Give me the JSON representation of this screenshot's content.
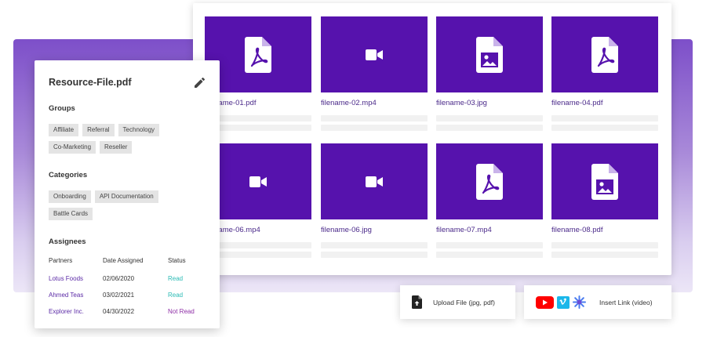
{
  "detail": {
    "title": "Resource-File.pdf",
    "groups_heading": "Groups",
    "groups": [
      "Affiliate",
      "Referral",
      "Technology",
      "Co-Marketing",
      "Reseller"
    ],
    "categories_heading": "Categories",
    "categories": [
      "Onboarding",
      "API Documentation",
      "Battle Cards"
    ],
    "assignees_heading": "Assignees",
    "table": {
      "headers": [
        "Partners",
        "Date Assigned",
        "Status"
      ],
      "rows": [
        {
          "partner": "Lotus Foods",
          "date": "02/06/2020",
          "status": "Read"
        },
        {
          "partner": "Ahmed Teas",
          "date": "03/02/2021",
          "status": "Read"
        },
        {
          "partner": "Explorer Inc.",
          "date": "04/30/2022",
          "status": "Not Read"
        }
      ]
    }
  },
  "files": [
    {
      "name": "filename-01.pdf",
      "icon": "pdf-file-icon"
    },
    {
      "name": "filename-02.mp4",
      "icon": "video-camera-icon"
    },
    {
      "name": "filename-03.jpg",
      "icon": "image-file-icon"
    },
    {
      "name": "filename-04.pdf",
      "icon": "pdf-file-icon"
    },
    {
      "name": "filename-06.mp4",
      "icon": "video-camera-icon"
    },
    {
      "name": "filename-06.jpg",
      "icon": "video-camera-icon"
    },
    {
      "name": "filename-07.mp4",
      "icon": "pdf-file-icon"
    },
    {
      "name": "filename-08.pdf",
      "icon": "image-file-icon"
    }
  ],
  "actions": {
    "upload_label": "Upload File (jpg, pdf)",
    "link_label": "Insert Link (video)"
  },
  "colors": {
    "accent": "#5612ad",
    "band_top": "#7d4fc9",
    "read": "#2bbbb5",
    "not_read": "#8e2ea6",
    "youtube": "#ff0000",
    "vimeo": "#1ab7ea",
    "wistia": "#54bbff"
  }
}
